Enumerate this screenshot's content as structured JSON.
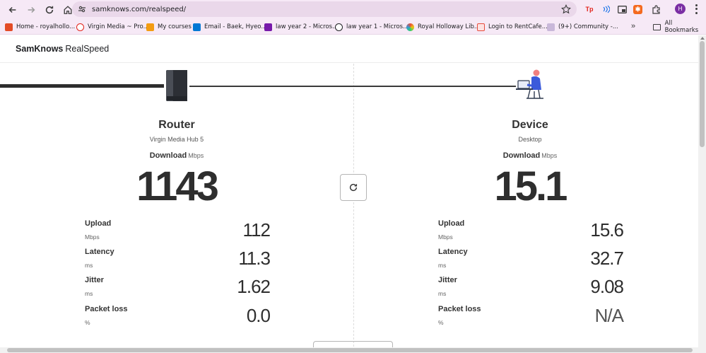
{
  "browser": {
    "url": "samknows.com/realspeed/",
    "avatar_letter": "H",
    "bookmarks": [
      {
        "label": "Home - royalhollo...",
        "color": "#e34c26"
      },
      {
        "label": "Virgin Media ~ Pro...",
        "color": "#e2231a"
      },
      {
        "label": "My courses",
        "color": "#f39c12"
      },
      {
        "label": "Email - Baek, Hyeo...",
        "color": "#0078d4"
      },
      {
        "label": "law year 2 - Micros...",
        "color": "#7719aa"
      },
      {
        "label": "law year 1 - Micros...",
        "color": "#202124"
      },
      {
        "label": "Royal Holloway Lib...",
        "color": "#e67e22"
      },
      {
        "label": "Login to RentCafe...",
        "color": "#e74c3c"
      },
      {
        "label": "(9+) Community -...",
        "color": "#c9b8d9"
      }
    ],
    "all_bookmarks": "All Bookmarks"
  },
  "header": {
    "brand_bold": "SamKnows",
    "brand_light": "RealSpeed"
  },
  "router": {
    "title": "Router",
    "subtitle": "Virgin Media Hub 5",
    "download_label": "Download",
    "download_unit": "Mbps",
    "download_value": "1143",
    "metrics": [
      {
        "label": "Upload",
        "unit": "Mbps",
        "value": "112"
      },
      {
        "label": "Latency",
        "unit": "ms",
        "value": "11.3"
      },
      {
        "label": "Jitter",
        "unit": "ms",
        "value": "1.62"
      },
      {
        "label": "Packet loss",
        "unit": "%",
        "value": "0.0"
      }
    ]
  },
  "device": {
    "title": "Device",
    "subtitle": "Desktop",
    "download_label": "Download",
    "download_unit": "Mbps",
    "download_value": "15.1",
    "metrics": [
      {
        "label": "Upload",
        "unit": "Mbps",
        "value": "15.6"
      },
      {
        "label": "Latency",
        "unit": "ms",
        "value": "32.7"
      },
      {
        "label": "Jitter",
        "unit": "ms",
        "value": "9.08"
      },
      {
        "label": "Packet loss",
        "unit": "%",
        "value": "N/A"
      }
    ]
  }
}
